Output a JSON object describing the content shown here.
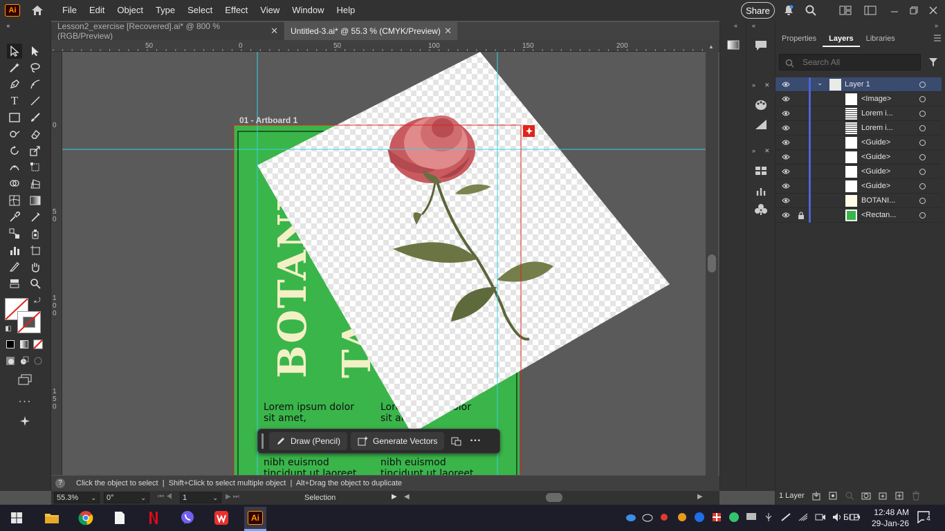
{
  "app": {
    "logo": "Ai",
    "home_icon": "home-icon"
  },
  "menu": {
    "items": [
      "File",
      "Edit",
      "Object",
      "Type",
      "Select",
      "Effect",
      "View",
      "Window",
      "Help"
    ]
  },
  "topbar": {
    "share": "Share"
  },
  "tabs": [
    {
      "label": "Lesson2_exercise [Recovered].ai* @ 800 % (RGB/Preview)",
      "close": "✕"
    },
    {
      "label": "Untitled-3.ai* @ 55.3 % (CMYK/Preview)",
      "close": "✕"
    }
  ],
  "rulers": {
    "h": [
      "50",
      "0",
      "50",
      "100",
      "150",
      "200"
    ],
    "v": [
      "0",
      "5\n0",
      "1\n0\n0",
      "1\n5\n0"
    ]
  },
  "artboard": {
    "label": "01 - Artboard 1",
    "title_text": "BOTANI",
    "title_text_2": "TA",
    "body_left": [
      "Lorem ipsum dolor",
      "sit amet,",
      "nibh euismod",
      "tincidunt ut laoreet"
    ],
    "body_right": [
      "Lorem ipsum dolor",
      "sit amet,",
      "nibh euismod",
      "tincidunt ut laoreet"
    ]
  },
  "context_bar": {
    "draw": "Draw (Pencil)",
    "generate": "Generate Vectors"
  },
  "status": {
    "text": "Click the object to select  |  Shift+Click to select multiple object  |  Alt+Drag the object to duplicate"
  },
  "bottom": {
    "zoom": "55.3%",
    "rotation": "0°",
    "artboard": "1",
    "mode": "Selection"
  },
  "panel": {
    "tabs": [
      "Properties",
      "Layers",
      "Libraries"
    ],
    "search_placeholder": "Search All",
    "layer_name": "Layer 1",
    "rows": [
      "<Image>",
      "Lorem i...",
      "Lorem i...",
      "<Guide>",
      "<Guide>",
      "<Guide>",
      "<Guide>",
      "BOTANI...",
      "<Rectan..."
    ],
    "footer": "1 Layer"
  },
  "taskbar": {
    "lang": "БГР",
    "time": "12:48 AM",
    "date": "29-Jan-26",
    "notif": "4"
  },
  "colors": {
    "artboard_green": "#3ab54a",
    "title_cream": "#f3f0c6",
    "guide": "#39d3e0",
    "bleed": "#e0231b",
    "layer_blue": "#4c63d6"
  }
}
